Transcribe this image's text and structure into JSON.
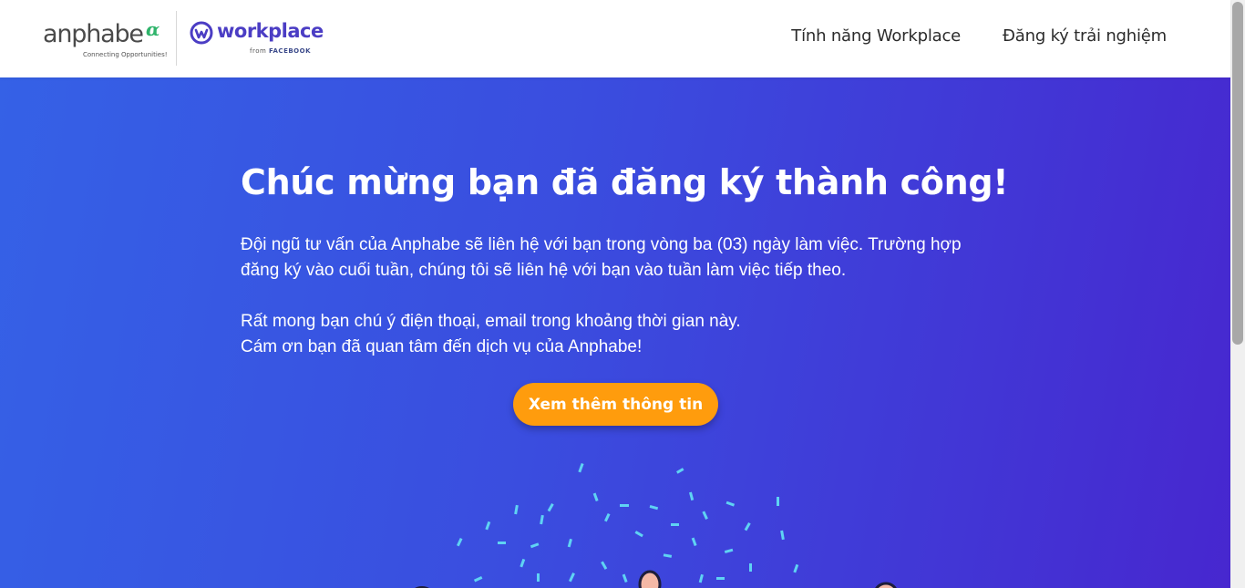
{
  "header": {
    "anphabe_logo": {
      "wordmark": "anphabe",
      "tagline": "Connecting Opportunities!"
    },
    "workplace_logo": {
      "wordmark": "workplace",
      "sub_prefix": "from",
      "sub_brand": "FACEBOOK"
    },
    "nav": [
      {
        "label": "Tính năng Workplace"
      },
      {
        "label": "Đăng ký trải nghiệm"
      }
    ]
  },
  "hero": {
    "title": "Chúc mừng bạn đã đăng ký thành công!",
    "paragraph1_line1": "Đội ngũ tư vấn của Anphabe sẽ liên hệ với bạn trong vòng ba (03) ngày làm việc. Trường hợp",
    "paragraph1_line2": "đăng ký vào cuối tuần, chúng tôi sẽ liên hệ với bạn vào tuần làm việc tiếp theo.",
    "paragraph2_line1": "Rất mong bạn chú ý điện thoại, email trong khoảng thời gian này.",
    "paragraph2_line2": "Cám ơn bạn đã quan tâm đến dịch vụ của Anphabe!",
    "cta_label": "Xem thêm thông tin"
  },
  "colors": {
    "brand_purple": "#4b3dc4",
    "cta_orange": "#ff9c0d",
    "hero_gradient_start": "#3561e6",
    "hero_gradient_end": "#4727cf",
    "anphabe_green": "#2fb46b"
  }
}
